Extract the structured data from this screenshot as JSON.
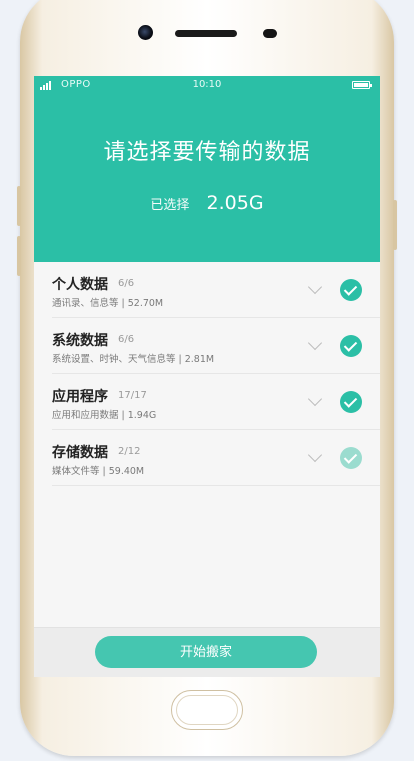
{
  "status_bar": {
    "carrier": "OPPO",
    "time": "10:10"
  },
  "header": {
    "title": "请选择要传输的数据",
    "selected_label": "已选择",
    "selected_value": "2.05G"
  },
  "items": [
    {
      "name": "个人数据",
      "count": "6/6",
      "desc": "通讯录、信息等 | 52.70M",
      "checked": true,
      "partial": false
    },
    {
      "name": "系统数据",
      "count": "6/6",
      "desc": "系统设置、时钟、天气信息等 | 2.81M",
      "checked": true,
      "partial": false
    },
    {
      "name": "应用程序",
      "count": "17/17",
      "desc": "应用和应用数据 | 1.94G",
      "checked": true,
      "partial": false
    },
    {
      "name": "存储数据",
      "count": "2/12",
      "desc": "媒体文件等 | 59.40M",
      "checked": true,
      "partial": true
    }
  ],
  "footer": {
    "start_label": "开始搬家"
  },
  "colors": {
    "accent": "#2bbfa6",
    "button": "#45c6b0",
    "partial_check": "#9bdccf"
  }
}
